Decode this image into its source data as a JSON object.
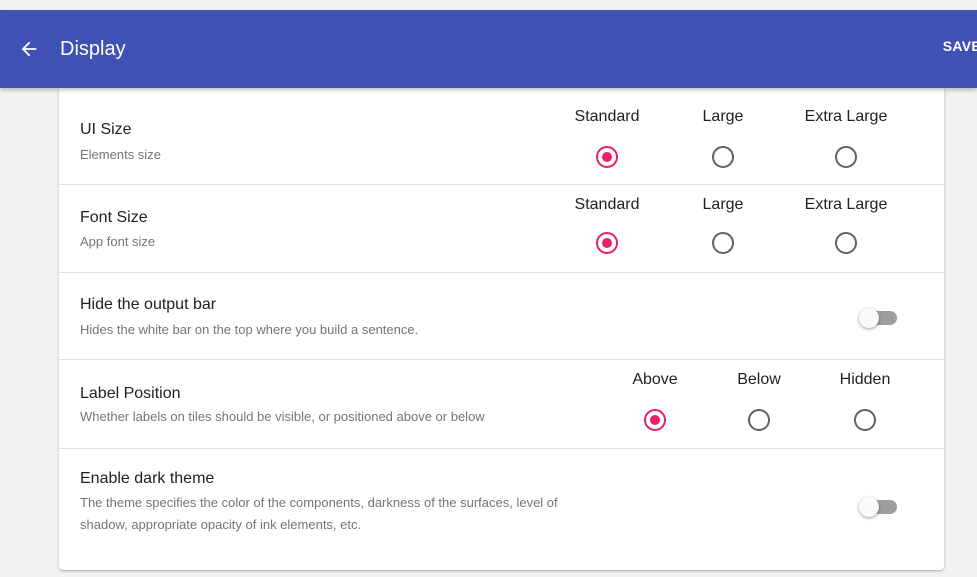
{
  "appbar": {
    "back_icon": "arrow-left-icon",
    "title": "Display",
    "save_label": "SAVE",
    "color": "#3f51b5"
  },
  "settings": {
    "ui_size": {
      "title": "UI Size",
      "subtitle": "Elements size",
      "options": [
        "Standard",
        "Large",
        "Extra Large"
      ],
      "selected": "Standard"
    },
    "font_size": {
      "title": "Font Size",
      "subtitle": "App font size",
      "options": [
        "Standard",
        "Large",
        "Extra Large"
      ],
      "selected": "Standard"
    },
    "hide_output_bar": {
      "title": "Hide the output bar",
      "subtitle": "Hides the white bar on the top where you build a sentence.",
      "enabled": false
    },
    "label_position": {
      "title": "Label Position",
      "subtitle": "Whether labels on tiles should be visible, or positioned above or below",
      "options": [
        "Above",
        "Below",
        "Hidden"
      ],
      "selected": "Above"
    },
    "dark_theme": {
      "title": "Enable dark theme",
      "subtitle_line1": "The theme specifies the color of the components, darkness of the surfaces, level of",
      "subtitle_line2": "shadow, appropriate opacity of ink elements, etc.",
      "enabled": false
    }
  },
  "colors": {
    "accent": "#e91e63",
    "radio_unchecked": "#616161",
    "switch_track_off": "#9e9e9e"
  }
}
